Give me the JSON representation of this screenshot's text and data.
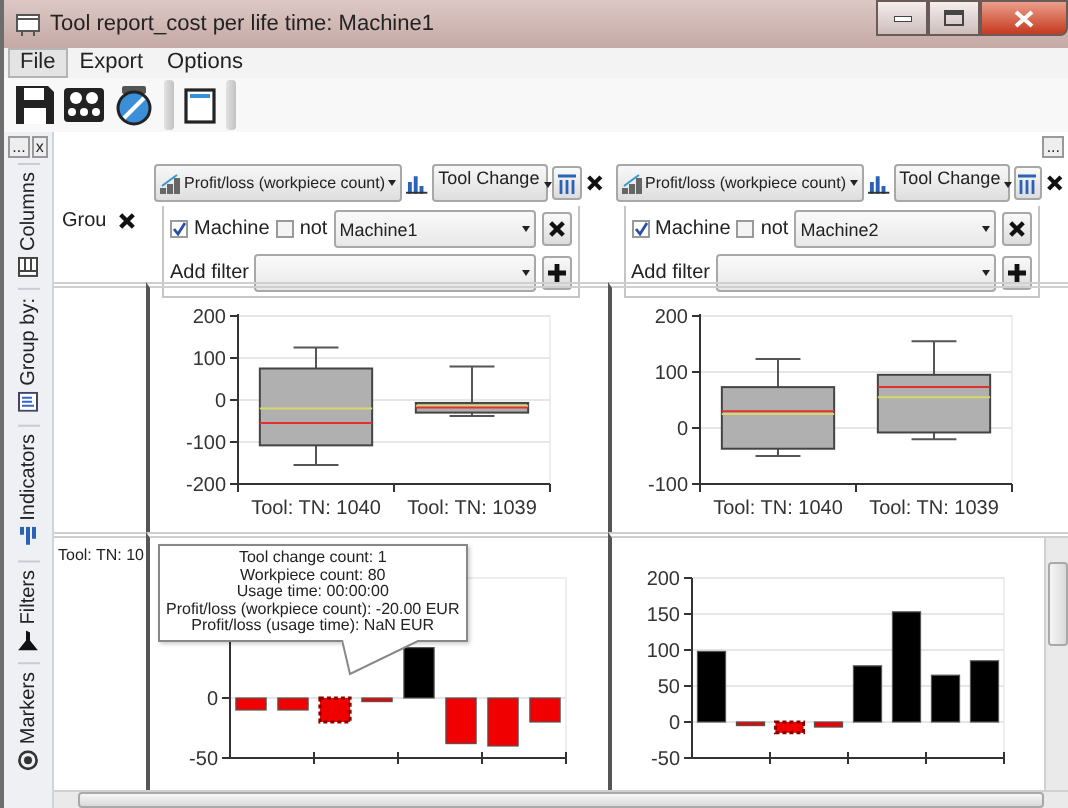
{
  "window": {
    "title": "Tool report_cost per life time: Machine1"
  },
  "menu": [
    {
      "label": "File",
      "selected": true
    },
    {
      "label": "Export",
      "selected": false
    },
    {
      "label": "Options",
      "selected": false
    }
  ],
  "corner_buttons": [
    "...",
    "x"
  ],
  "side_tabs": [
    {
      "label": "Columns",
      "kind": "columns"
    },
    {
      "label": "Group by:",
      "kind": "group"
    },
    {
      "label": "Indicators",
      "kind": "indicators"
    },
    {
      "label": "Filters",
      "kind": "filters"
    },
    {
      "label": "Markers",
      "kind": "markers"
    }
  ],
  "group_by": {
    "label": "Grou",
    "row_label": "Tool: TN: 10"
  },
  "panels": [
    {
      "indicator": "Profit/loss (workpiece count)",
      "group": "Tool Change",
      "filter": {
        "field": "Machine",
        "checked": true,
        "not_label": "not",
        "not": false,
        "value": "Machine1"
      },
      "add_filter": "Add filter",
      "box_chart": {
        "chart_data": {
          "type": "box",
          "grid": true,
          "categories": [
            "Tool: TN: 1040",
            "Tool: TN: 1039"
          ],
          "ylim": [
            -200,
            200
          ],
          "yticks": [
            200,
            100,
            0,
            -100,
            -200
          ],
          "boxes": [
            {
              "low": -155,
              "q1": -108,
              "median": -55,
              "mean": -20,
              "q3": 75,
              "high": 125
            },
            {
              "low": -38,
              "q1": -30,
              "median": -18,
              "mean": -14,
              "q3": -7,
              "high": 80
            }
          ]
        }
      },
      "bar_chart": {
        "chart_data": {
          "type": "bar",
          "grid": true,
          "values": [
            -10,
            -10,
            -20,
            -3,
            42,
            -38,
            -40,
            -20
          ],
          "ylim": [
            -50,
            100
          ],
          "yticks": [
            0,
            -50
          ]
        },
        "bars": [
          {
            "selected": false
          },
          {
            "selected": false
          },
          {
            "selected": true
          },
          {
            "selected": false
          },
          {
            "selected": false
          },
          {
            "selected": false
          },
          {
            "selected": false
          },
          {
            "selected": false
          }
        ]
      },
      "tooltip": [
        "Tool change count: 1",
        "Workpiece count: 80",
        "Usage time: 00:00:00",
        "Profit/loss (workpiece count): -20.00 EUR",
        "Profit/loss (usage time): NaN EUR"
      ]
    },
    {
      "corner_button": "...",
      "indicator": "Profit/loss (workpiece count)",
      "group": "Tool Change",
      "filter": {
        "field": "Machine",
        "checked": true,
        "not_label": "not",
        "not": false,
        "value": "Machine2"
      },
      "add_filter": "Add filter",
      "box_chart": {
        "chart_data": {
          "type": "box",
          "grid": true,
          "categories": [
            "Tool: TN: 1040",
            "Tool: TN: 1039"
          ],
          "ylim": [
            -100,
            200
          ],
          "yticks": [
            200,
            100,
            0,
            -100
          ],
          "boxes": [
            {
              "low": -50,
              "q1": -37,
              "median": 30,
              "mean": 25,
              "q3": 73,
              "high": 123
            },
            {
              "low": -20,
              "q1": -8,
              "median": 73,
              "mean": 55,
              "q3": 95,
              "high": 155
            }
          ]
        }
      },
      "bar_chart": {
        "chart_data": {
          "type": "bar",
          "grid": true,
          "values": [
            98,
            -5,
            -15,
            -7,
            78,
            153,
            65,
            85
          ],
          "ylim": [
            -50,
            200
          ],
          "yticks": [
            200,
            150,
            100,
            50,
            0,
            -50
          ]
        },
        "bars": [
          {
            "selected": false
          },
          {
            "selected": false
          },
          {
            "selected": true
          },
          {
            "selected": false
          },
          {
            "selected": false
          },
          {
            "selected": false
          },
          {
            "selected": false
          },
          {
            "selected": false
          }
        ]
      }
    }
  ]
}
